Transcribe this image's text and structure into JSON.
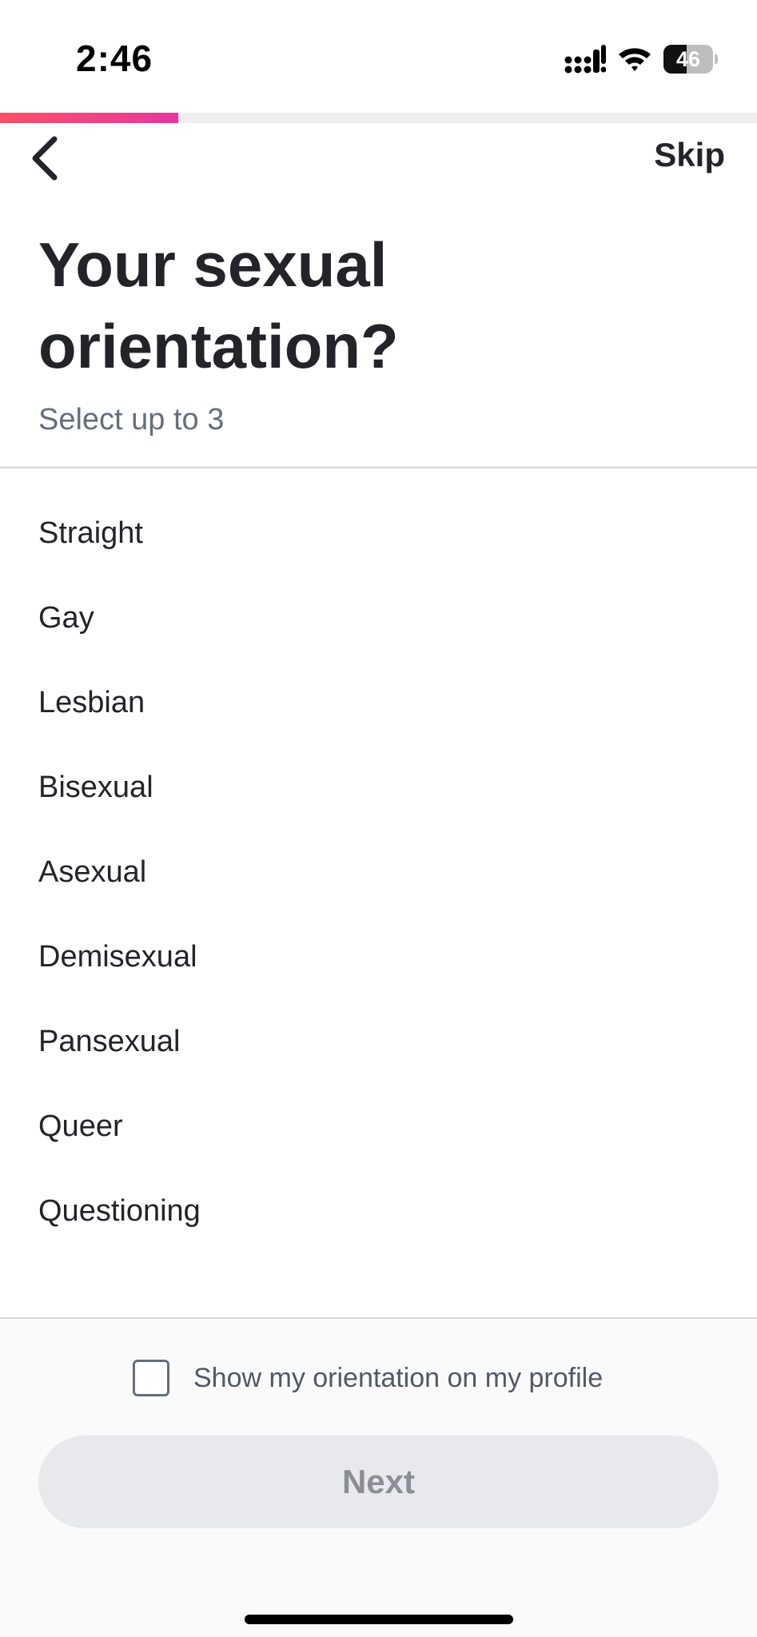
{
  "status_bar": {
    "time": "2:46",
    "battery_level": "46",
    "battery_fraction": 0.46,
    "icons": [
      "cellular-signal-icon",
      "wifi-icon",
      "battery-icon"
    ]
  },
  "progress": {
    "fraction": 0.236,
    "colors": [
      "#fd5068",
      "#e4389f"
    ]
  },
  "nav": {
    "back_icon": "chevron-left-icon",
    "skip_label": "Skip"
  },
  "header": {
    "title": "Your sexual orientation?",
    "subtitle": "Select up to 3"
  },
  "options": [
    {
      "label": "Straight"
    },
    {
      "label": "Gay"
    },
    {
      "label": "Lesbian"
    },
    {
      "label": "Bisexual"
    },
    {
      "label": "Asexual"
    },
    {
      "label": "Demisexual"
    },
    {
      "label": "Pansexual"
    },
    {
      "label": "Queer"
    },
    {
      "label": "Questioning"
    }
  ],
  "footer": {
    "show_on_profile_label": "Show my orientation on my profile",
    "show_on_profile_checked": false,
    "next_label": "Next",
    "next_enabled": false
  }
}
